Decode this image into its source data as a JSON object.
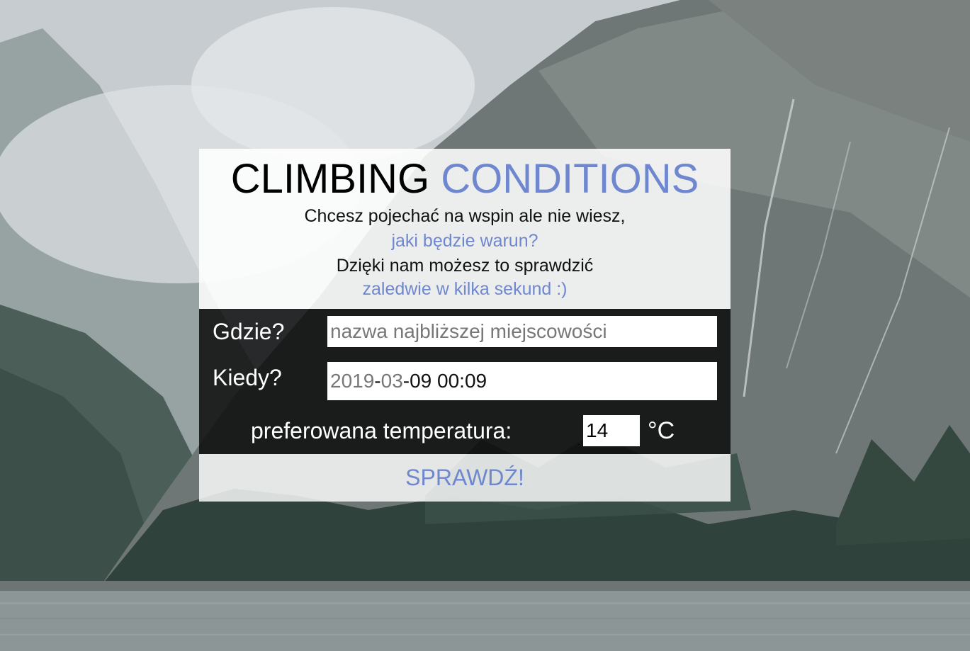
{
  "header": {
    "title_main": "CLIMBING",
    "title_accent": "CONDITIONS",
    "line1": "Chcesz pojechać na wspin ale nie wiesz,",
    "line2": "jaki będzie warun?",
    "line3": "Dzięki nam możesz to sprawdzić",
    "line4": "zaledwie w kilka sekund :)"
  },
  "form": {
    "where_label": "Gdzie?",
    "where_placeholder": "nazwa najbliższej miejscowości",
    "when_label": "Kiedy?",
    "when_value": {
      "year": "2019",
      "sep1": "-",
      "month": "03",
      "rest": "-09 00:09"
    },
    "temp_label": "preferowana temperatura:",
    "temp_value": "14",
    "temp_unit": "°C",
    "submit_label": "SPRAWDŹ!"
  },
  "colors": {
    "accent": "#6f87cf",
    "form_background": "#0a0a0a",
    "header_background": "#ffffff"
  }
}
